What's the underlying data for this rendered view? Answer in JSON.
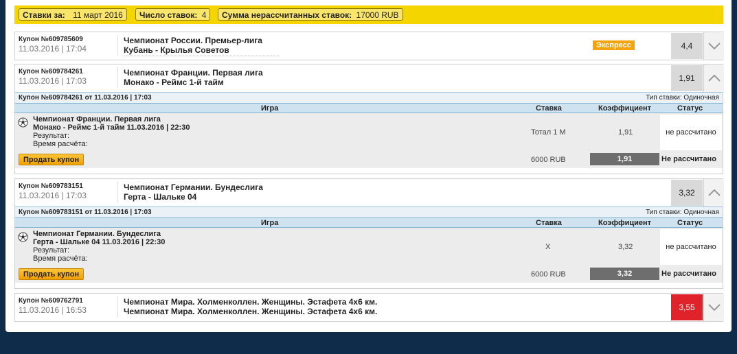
{
  "summary": {
    "date_label": "Ставки за:",
    "date_value": "11 март 2016",
    "count_label": "Число ставок:",
    "count_value": "4",
    "sum_label": "Сумма нерассчитанных ставок:",
    "sum_value": "17000 RUB"
  },
  "coupons": [
    {
      "id": "Купон №609785609",
      "datetime": "11.03.2016 | 17:04",
      "line1": "Чемпионат России. Премьер-лига",
      "line2": "Кубань - Крылья Советов",
      "badge": "Экспресс",
      "odds": "4,4"
    },
    {
      "id": "Купон №609784261",
      "datetime": "11.03.2016 | 17:03",
      "line1": "Чемпионат Франции. Первая лига",
      "line2": "Монако - Реймс 1-й тайм",
      "odds": "1,91",
      "details": {
        "title": "Купон №609784261 от 11.03.2016 | 17:03",
        "type": "Тип ставки: Одиночная",
        "col_game": "Игра",
        "col_bet": "Ставка",
        "col_coef": "Коэффициент",
        "col_status": "Статус",
        "game_line1": "Чемпионат Франции. Первая лига",
        "game_line2": "Монако - Реймс 1-й тайм 11.03.2016 | 22:30",
        "result_label": "Результат:",
        "calc_label": "Время расчёта:",
        "bet": "Тотал 1 М",
        "coef": "1,91",
        "status": "не рассчитано",
        "sell_label": "Продать купон",
        "amount": "6000 RUB",
        "total_coef": "1,91",
        "total_status": "Не рассчитано"
      }
    },
    {
      "id": "Купон №609783151",
      "datetime": "11.03.2016 | 17:03",
      "line1": "Чемпионат Германии. Бундеслига",
      "line2": "Герта - Шальке 04",
      "odds": "3,32",
      "details": {
        "title": "Купон №609783151 от 11.03.2016 | 17:03",
        "type": "Тип ставки: Одиночная",
        "col_game": "Игра",
        "col_bet": "Ставка",
        "col_coef": "Коэффициент",
        "col_status": "Статус",
        "game_line1": "Чемпионат Германии. Бундеслига",
        "game_line2": "Герта - Шальке 04 11.03.2016 | 22:30",
        "result_label": "Результат:",
        "calc_label": "Время расчёта:",
        "bet": "X",
        "coef": "3,32",
        "status": "не рассчитано",
        "sell_label": "Продать купон",
        "amount": "6000 RUB",
        "total_coef": "3,32",
        "total_status": "Не рассчитано"
      }
    },
    {
      "id": "Купон №609762791",
      "datetime": "11.03.2016 | 16:53",
      "line1": "Чемпионат Мира. Холменколлен. Женщины. Эстафета 4x6 км.",
      "line2": "Чемпионат Мира. Холменколлен. Женщины. Эстафета 4x6 км.",
      "odds": "3,55"
    }
  ]
}
